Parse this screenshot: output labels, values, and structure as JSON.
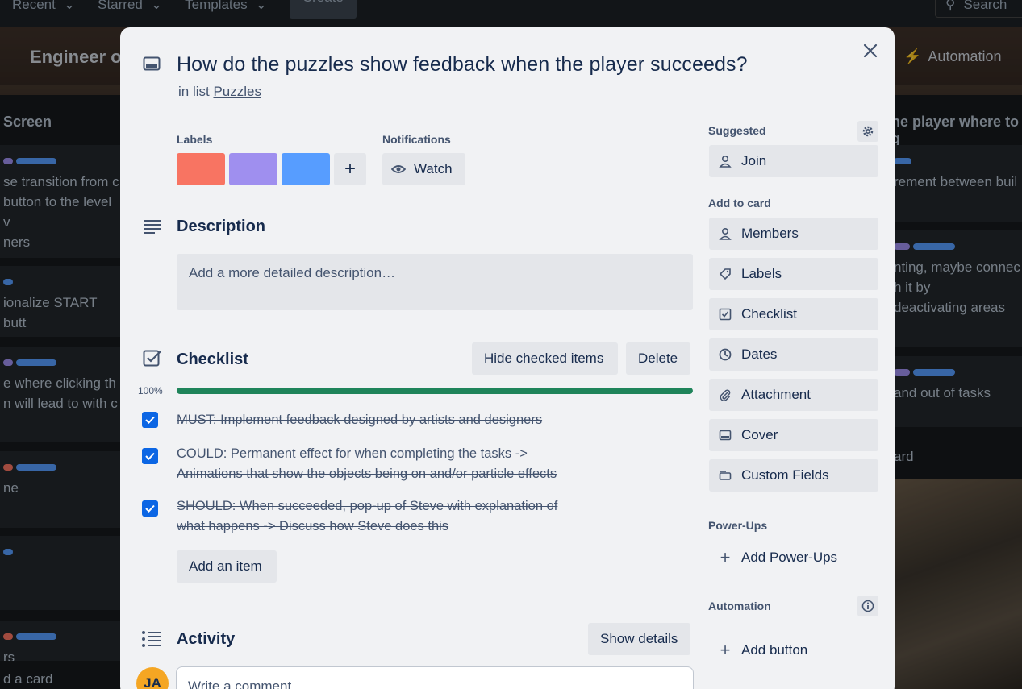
{
  "topnav": {
    "recent": "Recent",
    "starred": "Starred",
    "templates": "Templates",
    "create": "Create",
    "search": "Search"
  },
  "board": {
    "title": "Engineer o",
    "automation": "Automation",
    "left_list": {
      "header": "Screen",
      "cards": [
        {
          "text": "se transition from c\nbutton to the level v\nners"
        },
        {
          "text": "ionalize START butt\ned"
        },
        {
          "text": "e where clicking th\nn will lead to with c"
        },
        {
          "text": "ne"
        },
        {
          "text": ""
        },
        {
          "text": "rs"
        }
      ],
      "add_card": "d a card"
    },
    "right_list": {
      "header": "ne player where to g",
      "cards": [
        {
          "text": "rement between buil"
        },
        {
          "text": "nting, maybe connec\nh it by\ndeactivating areas"
        },
        {
          "text": "and out of tasks"
        }
      ],
      "add_card": "ard"
    }
  },
  "modal": {
    "title": "How do the puzzles show feedback when the player succeeds?",
    "in_list_prefix": "in list ",
    "list_name": "Puzzles",
    "labels_heading": "Labels",
    "labels": [
      {
        "color": "#f87462"
      },
      {
        "color": "#9f8fef"
      },
      {
        "color": "#579dff"
      }
    ],
    "notifications_heading": "Notifications",
    "watch_label": "Watch",
    "description_heading": "Description",
    "description_placeholder": "Add a more detailed description…",
    "checklist": {
      "heading": "Checklist",
      "hide_checked": "Hide checked items",
      "delete": "Delete",
      "progress_text": "100%",
      "progress": 1.0,
      "items": [
        {
          "text": "MUST: Implement feedback designed by artists and designers",
          "checked": true
        },
        {
          "text": "COULD: Permanent effect for when completing the tasks -> Animations that show the objects being on and/or particle effects",
          "checked": true
        },
        {
          "text": "SHOULD: When succeeded, pop-up of Steve with explanation of what happens -> Discuss how Steve does this",
          "checked": true
        }
      ],
      "add_item": "Add an item"
    },
    "activity": {
      "heading": "Activity",
      "show_details": "Show details",
      "avatar_initials": "JA",
      "comment_placeholder": "Write a comment…"
    },
    "sidebar": {
      "suggested": "Suggested",
      "join": "Join",
      "add_to_card": "Add to card",
      "members": "Members",
      "labels": "Labels",
      "checklist": "Checklist",
      "dates": "Dates",
      "attachment": "Attachment",
      "cover": "Cover",
      "custom_fields": "Custom Fields",
      "power_ups": "Power-Ups",
      "add_power_ups": "Add Power-Ups",
      "automation": "Automation",
      "add_button": "Add button"
    }
  }
}
